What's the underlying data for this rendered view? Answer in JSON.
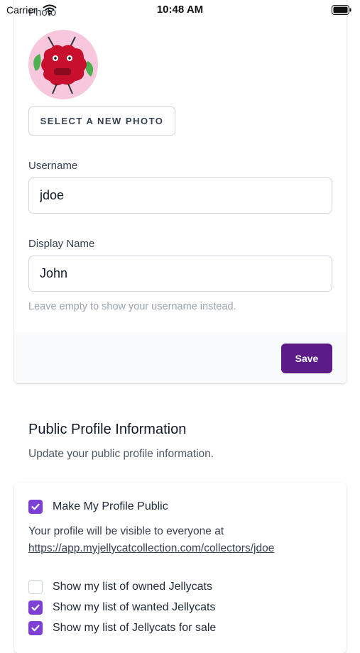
{
  "status_bar": {
    "carrier": "Carrier",
    "time": "10:48 AM"
  },
  "profile_form": {
    "photo_label": "Photo",
    "select_photo_label": "SELECT A NEW PHOTO",
    "username_label": "Username",
    "username_value": "jdoe",
    "display_name_label": "Display Name",
    "display_name_value": "John",
    "display_name_help": "Leave empty to show your username instead.",
    "save_label": "Save"
  },
  "public_profile": {
    "title": "Public Profile Information",
    "description": "Update your public profile information.",
    "make_public": {
      "label": "Make My Profile Public",
      "checked": true
    },
    "visibility_text": "Your profile will be visible to everyone at",
    "profile_url": "https://app.myjellycatcollection.com/collectors/jdoe",
    "options": [
      {
        "label": "Show my list of owned Jellycats",
        "checked": false
      },
      {
        "label": "Show my list of wanted Jellycats",
        "checked": true
      },
      {
        "label": "Show my list of Jellycats for sale",
        "checked": true
      }
    ]
  },
  "colors": {
    "primary": "#5b1c8a",
    "checkbox_checked": "#7e3fd4",
    "avatar_background": "#f7c7de"
  },
  "icons": [
    "wifi-icon",
    "battery-icon",
    "check-icon"
  ]
}
